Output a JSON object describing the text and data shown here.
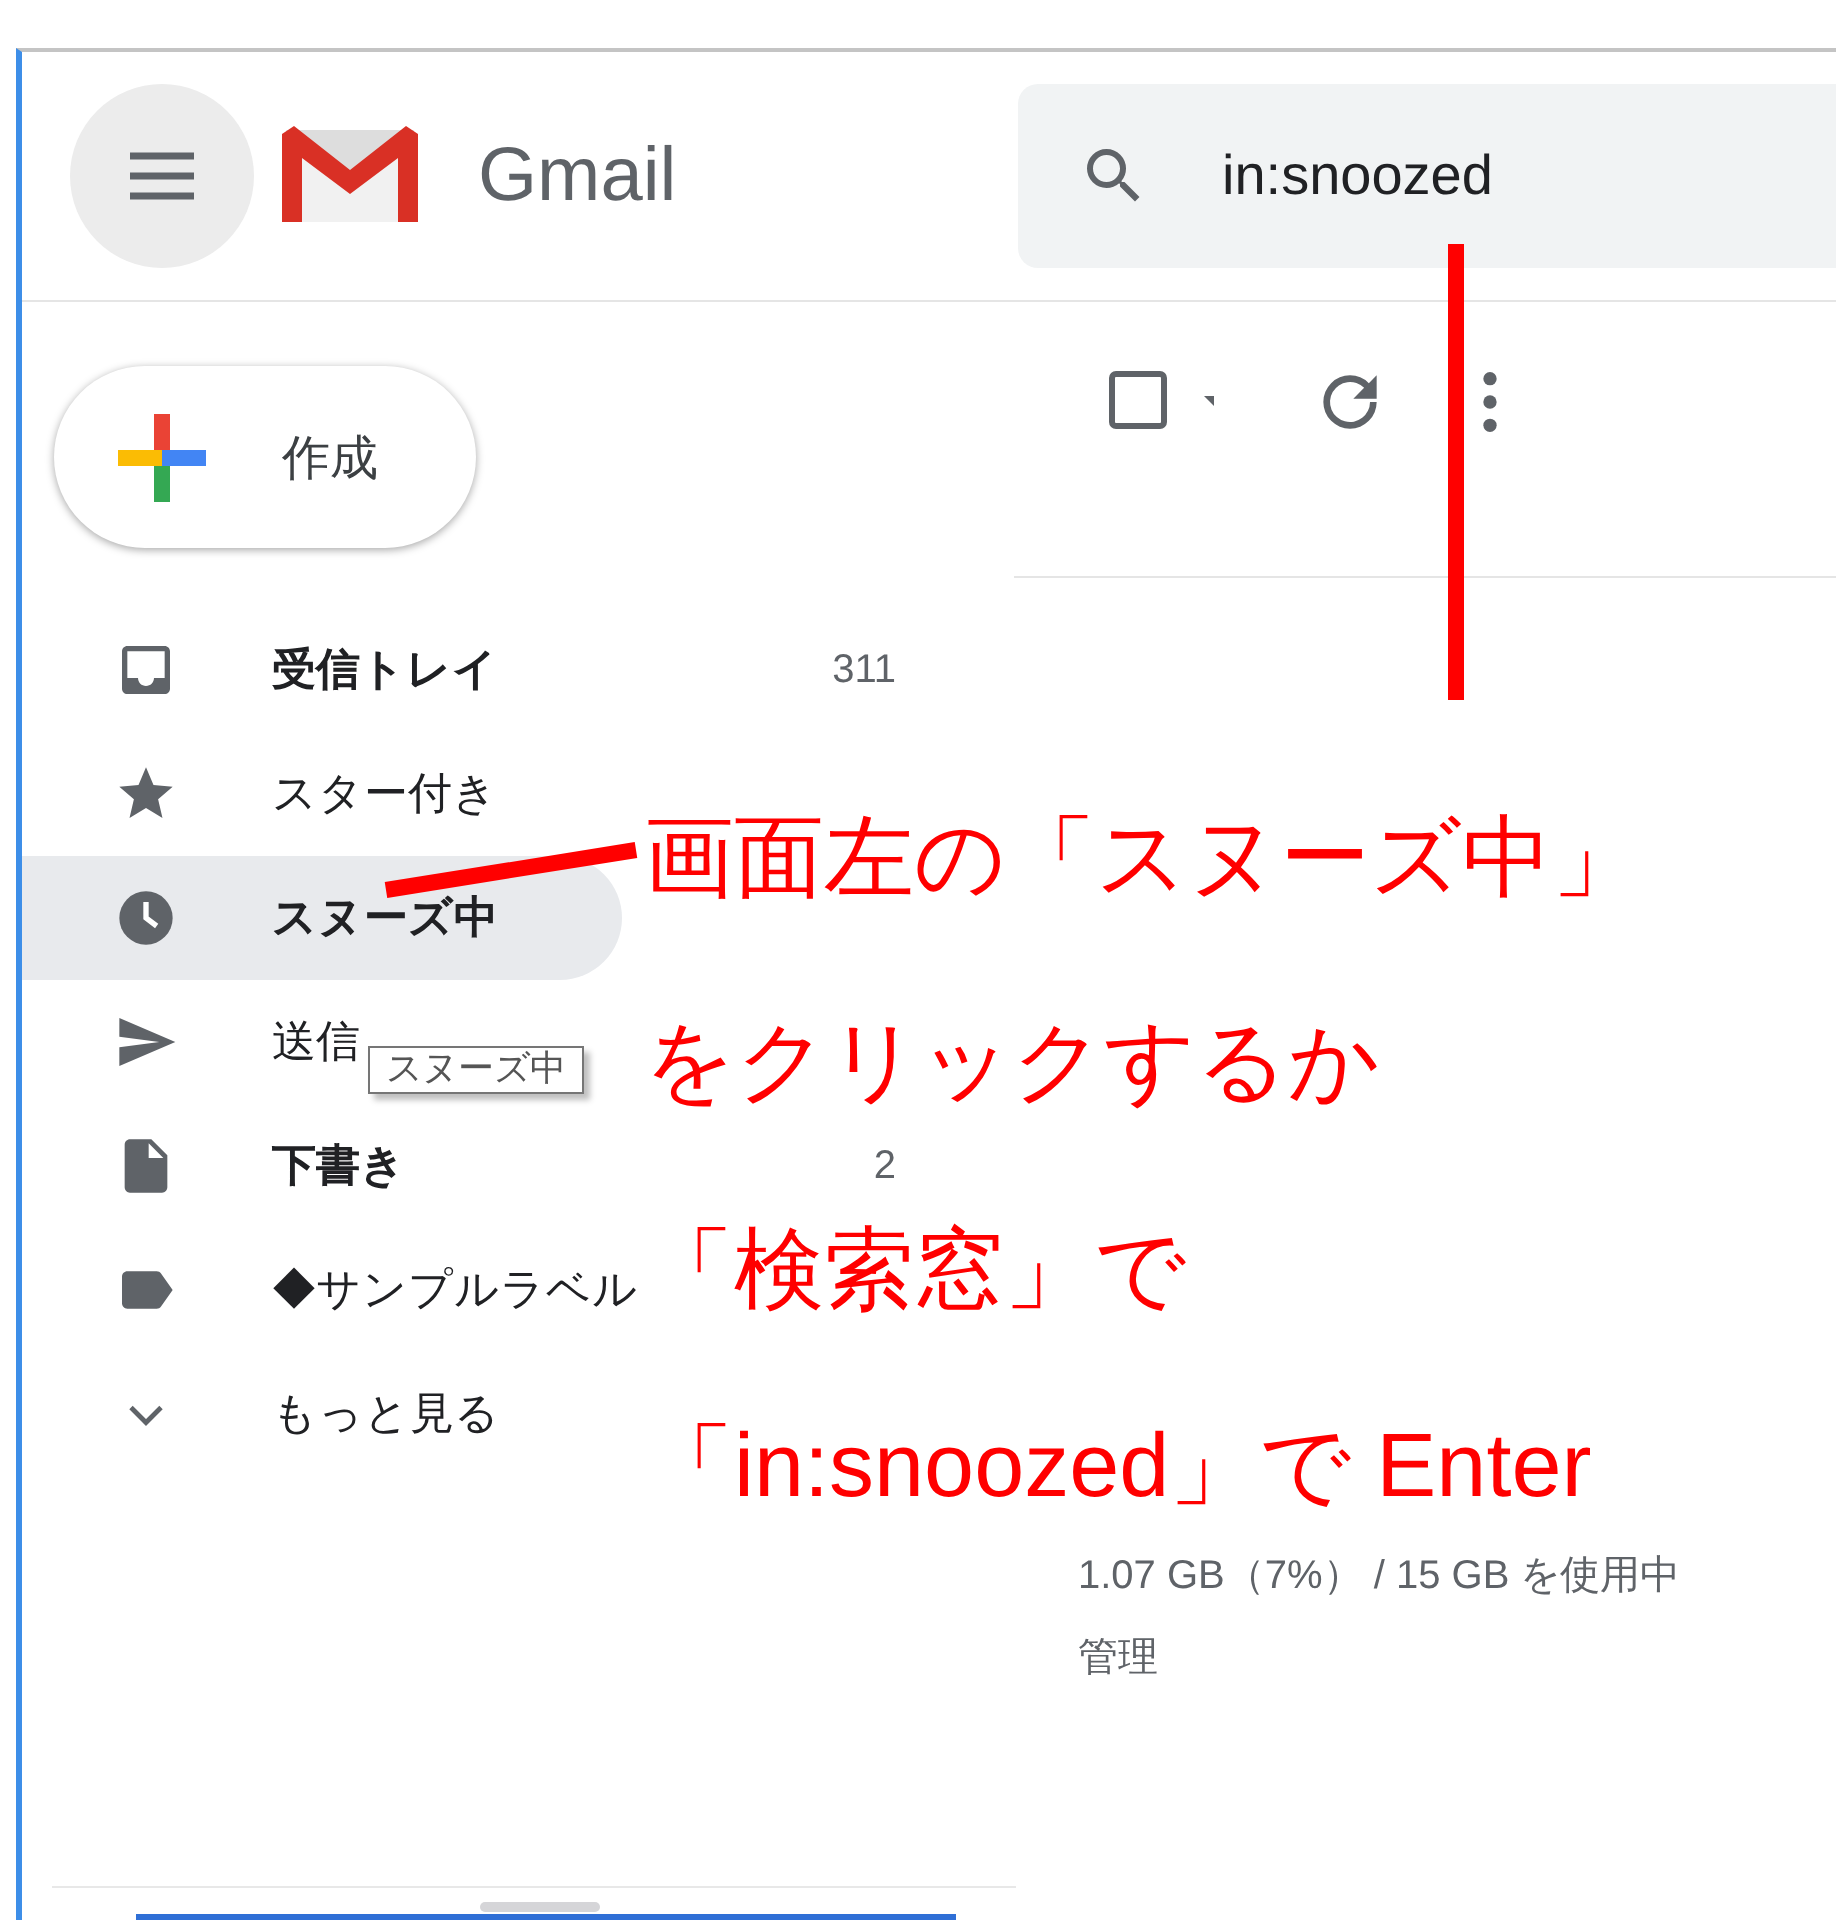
{
  "header": {
    "app_name": "Gmail",
    "search": {
      "value": "in:snoozed"
    }
  },
  "compose": {
    "label": "作成"
  },
  "nav": [
    {
      "kind": "inbox",
      "label": "受信トレイ",
      "count": "311",
      "bold": true,
      "selected": false
    },
    {
      "kind": "star",
      "label": "スター付き",
      "bold": false,
      "selected": false
    },
    {
      "kind": "clock",
      "label": "スヌーズ中",
      "bold": true,
      "selected": true
    },
    {
      "kind": "send",
      "label": "送信",
      "bold": false,
      "selected": false
    },
    {
      "kind": "draft",
      "label": "下書き",
      "count": "2",
      "bold": true,
      "selected": false
    },
    {
      "kind": "label",
      "label": "◆サンプルラベル",
      "bold": false,
      "selected": false
    },
    {
      "kind": "more",
      "label": "もっと見る",
      "bold": false,
      "selected": false
    }
  ],
  "tooltip": "スヌーズ中",
  "storage": {
    "usage": "1.07 GB（7%） / 15 GB を使用中",
    "manage": "管理"
  },
  "annotation": [
    "画面左の「スヌーズ中」",
    "をクリックするか",
    "「検索窓」で",
    "「in:snoozed」で Enter"
  ]
}
